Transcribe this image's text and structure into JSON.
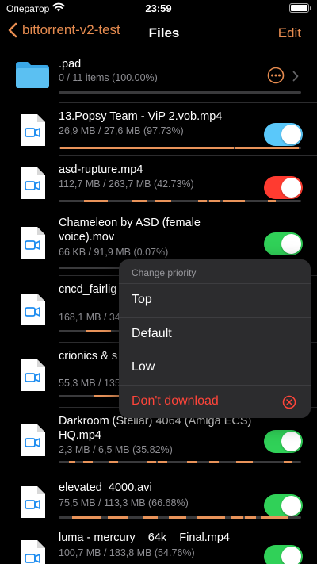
{
  "status_bar": {
    "carrier": "Оператор",
    "time": "23:59"
  },
  "nav": {
    "back_label": "bittorrent-v2-test",
    "title": "Files",
    "edit_label": "Edit"
  },
  "colors": {
    "accent": "#e78c50",
    "progress": "#e8935a",
    "toggle_on": "#30d158",
    "toggle_blue": "#5ac8fa",
    "toggle_red": "#ff3b30"
  },
  "files": [
    {
      "name": ".pad",
      "size": "0 / 11 items (100.00%)",
      "kind": "folder",
      "progress": 0
    },
    {
      "name": "13.Popsy Team - ViP 2.vob.mp4",
      "size": "26,9 MB / 27,6 MB (97.73%)",
      "kind": "video",
      "toggle_color": "blue",
      "progress": 0.9773
    },
    {
      "name": "asd-rupture.mp4",
      "size": "112,7 MB / 263,7 MB (42.73%)",
      "kind": "video",
      "toggle_color": "red",
      "progress": 0.4273
    },
    {
      "name": "Chameleon by ASD (female voice).mov",
      "size": "66 KB / 91,9 MB (0.07%)",
      "kind": "video",
      "toggle_color": "green",
      "progress": 0.0007
    },
    {
      "name": "cncd_fairlig ceasefire_(",
      "size": "168,1 MB / 34",
      "kind": "video",
      "toggle_color": "green",
      "progress": 0.49
    },
    {
      "name": "crionics & s hpad, divx5",
      "size": "55,3 MB / 135",
      "kind": "video",
      "toggle_color": "green",
      "progress": 0.41
    },
    {
      "name": "Darkroom (Stellar) 4064 (Amiga ECS) HQ.mp4",
      "size": "2,3 MB / 6,5 MB (35.82%)",
      "kind": "video",
      "toggle_color": "green",
      "progress": 0.3582
    },
    {
      "name": "elevated_4000.avi",
      "size": "75,5 MB / 113,3 MB (66.68%)",
      "kind": "video",
      "toggle_color": "green",
      "progress": 0.6668
    },
    {
      "name": "luma - mercury _ 64k _ Final.mp4",
      "size": "100,7 MB / 183,8 MB (54.76%)",
      "kind": "video",
      "toggle_color": "green",
      "progress": 0.5476
    }
  ],
  "priority_menu": {
    "title": "Change priority",
    "items": [
      {
        "label": "Top",
        "destructive": false
      },
      {
        "label": "Default",
        "destructive": false
      },
      {
        "label": "Low",
        "destructive": false
      },
      {
        "label": "Don't download",
        "destructive": true,
        "icon": "x-circle-icon"
      }
    ]
  }
}
